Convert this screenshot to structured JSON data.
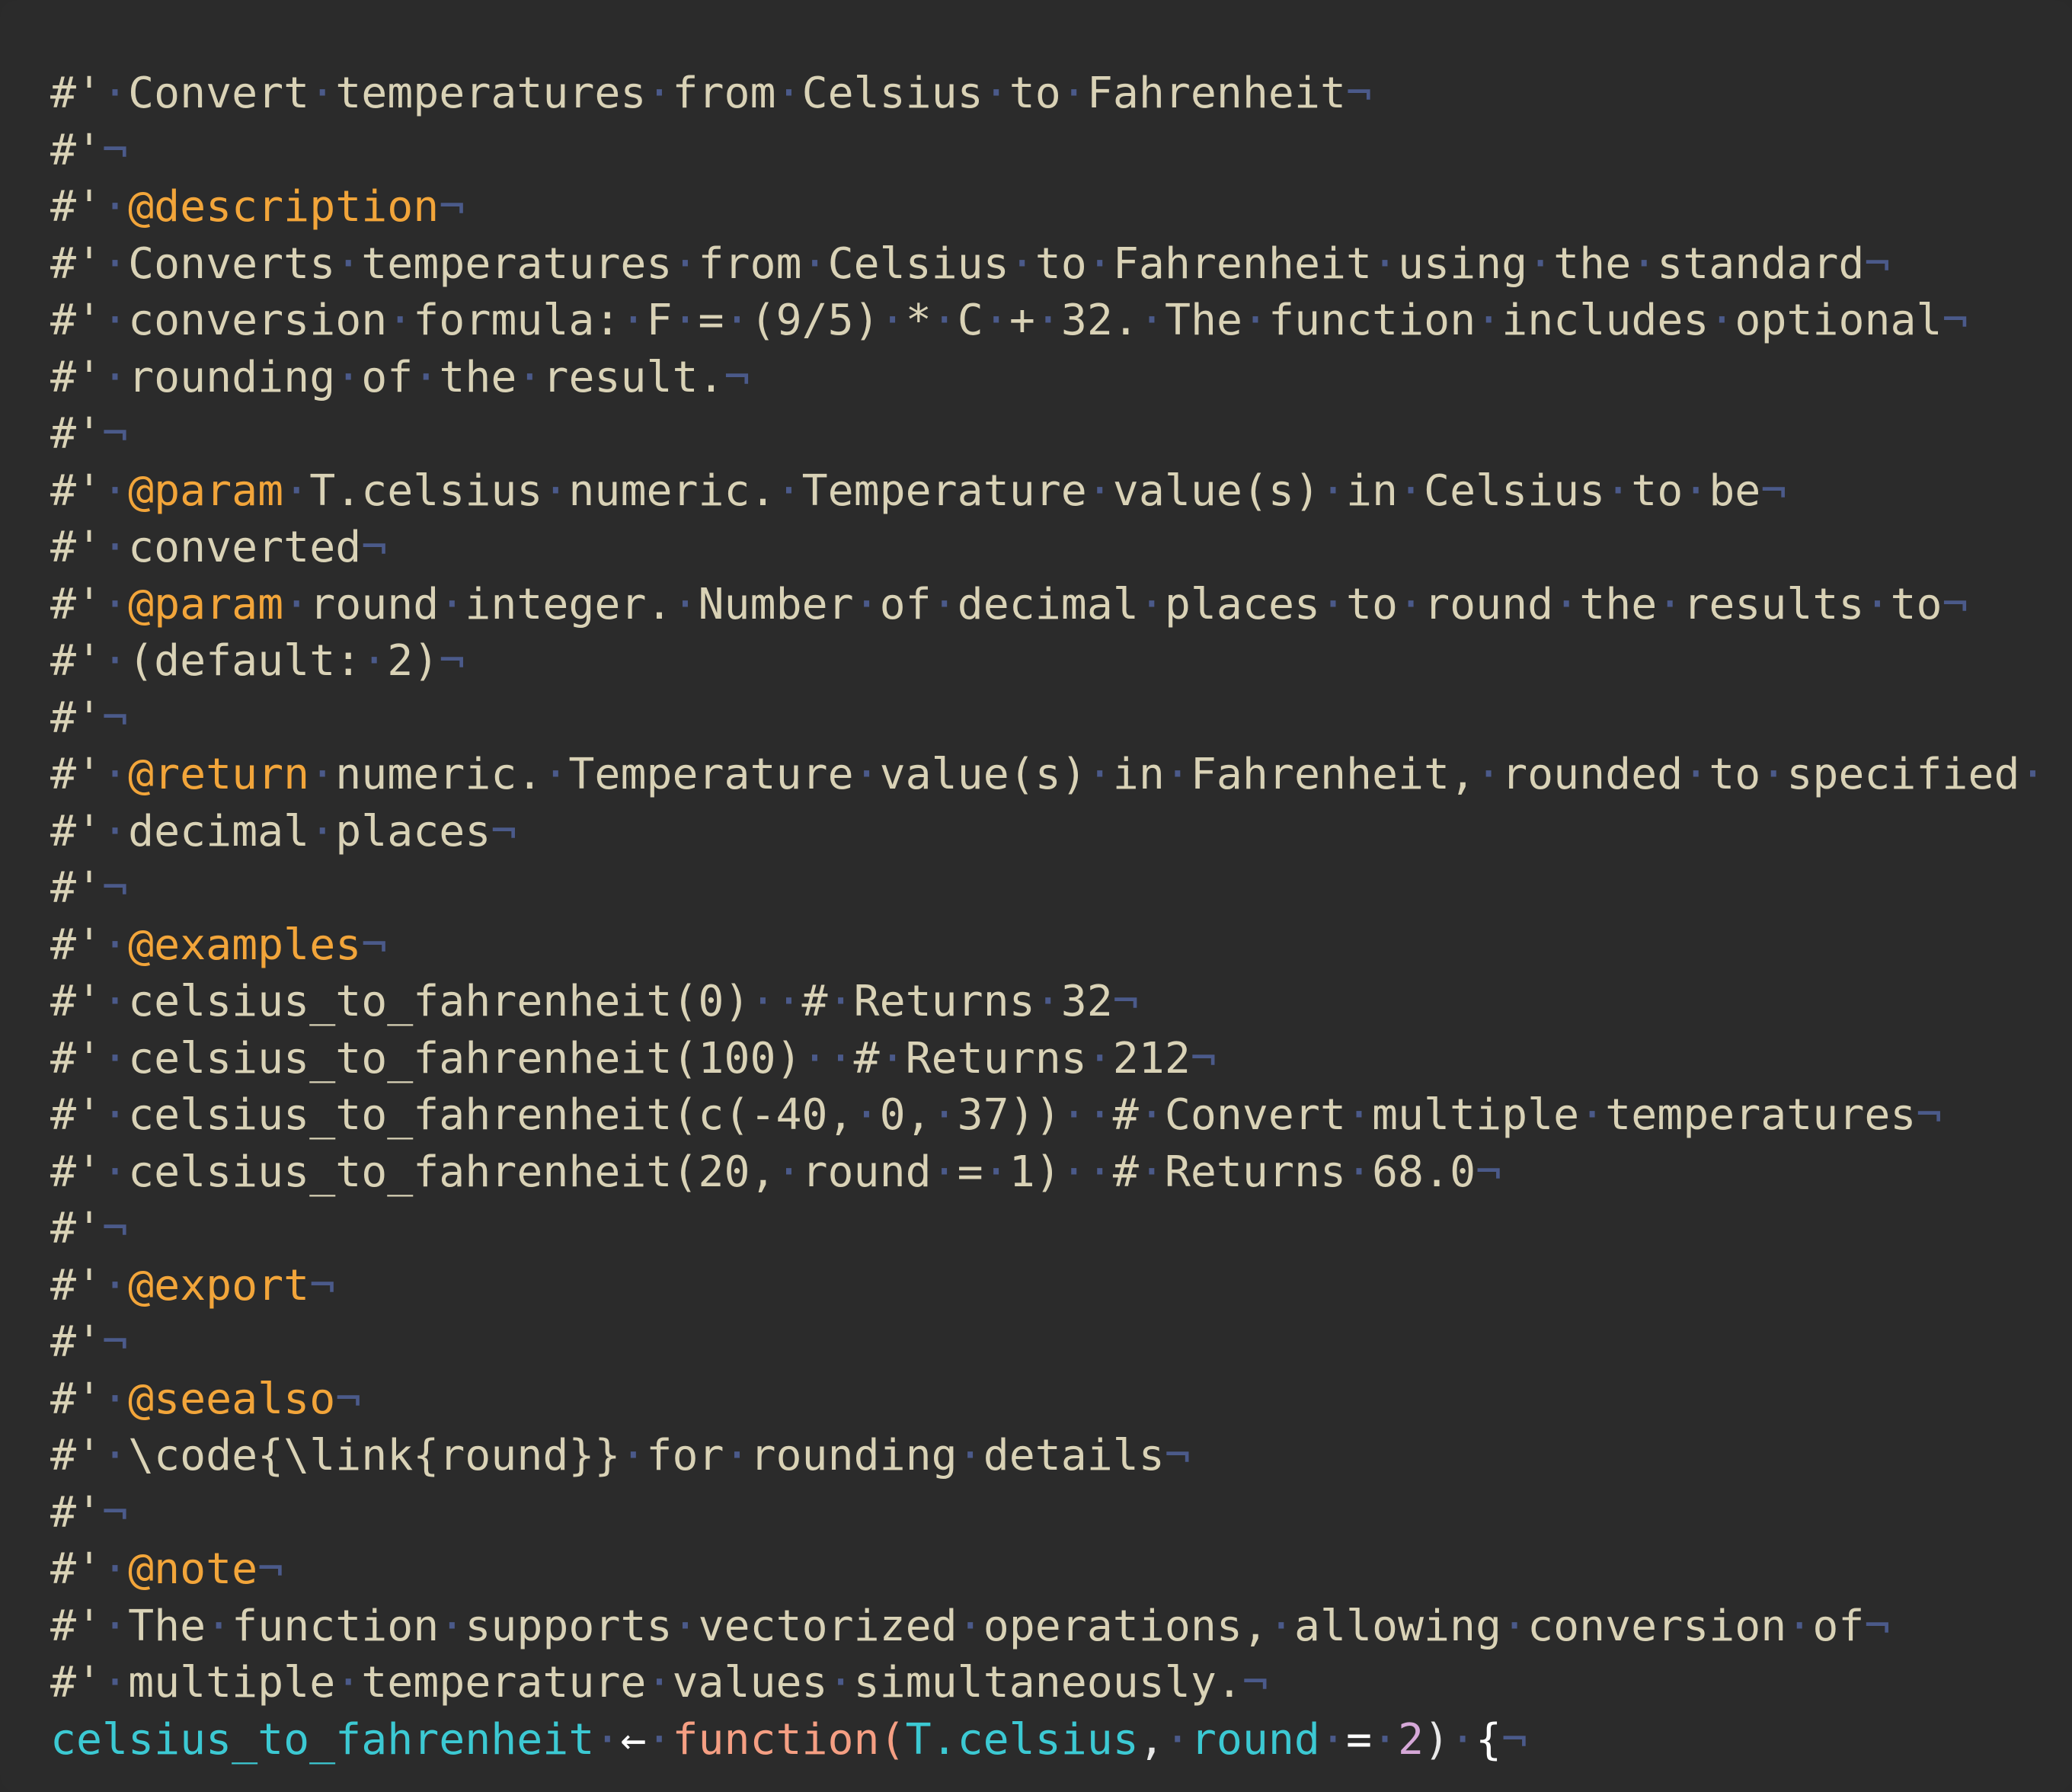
{
  "editor": {
    "whitespace_glyph": "·",
    "eol_glyph": "¬",
    "colors": {
      "background": "#2b2b2b",
      "text": "#d9d2b6",
      "whitespace_marker": "#4b5a8a",
      "roxygen_tag": "#f2a53a",
      "identifier": "#3cc9d3",
      "keyword": "#f59f83",
      "number": "#d6a8d8",
      "operator": "#ffffff"
    },
    "lines": [
      {
        "kind": "comment",
        "text": "Convert temperatures from Celsius to Fahrenheit",
        "eol": true
      },
      {
        "kind": "empty",
        "eol": true
      },
      {
        "kind": "tag",
        "tag": "@description",
        "text": "",
        "eol": true
      },
      {
        "kind": "comment",
        "text": "Converts temperatures from Celsius to Fahrenheit using the standard",
        "eol": true
      },
      {
        "kind": "comment",
        "text": "conversion formula: F = (9/5) * C + 32. The function includes optional",
        "eol": true
      },
      {
        "kind": "comment",
        "text": "rounding of the result.",
        "eol": true
      },
      {
        "kind": "empty",
        "eol": true
      },
      {
        "kind": "tag",
        "tag": "@param",
        "text": "T.celsius numeric. Temperature value(s) in Celsius to be",
        "eol": true
      },
      {
        "kind": "comment",
        "text": "converted",
        "eol": true
      },
      {
        "kind": "tag",
        "tag": "@param",
        "text": "round integer. Number of decimal places to round the results to",
        "eol": true
      },
      {
        "kind": "comment",
        "text": "(default: 2)",
        "eol": true
      },
      {
        "kind": "empty",
        "eol": true
      },
      {
        "kind": "tag",
        "tag": "@return",
        "text": "numeric. Temperature value(s) in Fahrenheit, rounded to specified ",
        "eol": false
      },
      {
        "kind": "comment",
        "text": "decimal places",
        "eol": true
      },
      {
        "kind": "empty",
        "eol": true
      },
      {
        "kind": "tag",
        "tag": "@examples",
        "text": "",
        "eol": true
      },
      {
        "kind": "comment",
        "text": "celsius_to_fahrenheit(0)  # Returns 32",
        "eol": true
      },
      {
        "kind": "comment",
        "text": "celsius_to_fahrenheit(100)  # Returns 212",
        "eol": true
      },
      {
        "kind": "comment",
        "text": "celsius_to_fahrenheit(c(-40, 0, 37))  # Convert multiple temperatures",
        "eol": true
      },
      {
        "kind": "comment",
        "text": "celsius_to_fahrenheit(20, round = 1)  # Returns 68.0",
        "eol": true
      },
      {
        "kind": "empty",
        "eol": true
      },
      {
        "kind": "tag",
        "tag": "@export",
        "text": "",
        "eol": true
      },
      {
        "kind": "empty",
        "eol": true
      },
      {
        "kind": "tag",
        "tag": "@seealso",
        "text": "",
        "eol": true
      },
      {
        "kind": "comment",
        "text": "\\code{\\link{round}} for rounding details",
        "eol": true
      },
      {
        "kind": "empty",
        "eol": true
      },
      {
        "kind": "tag",
        "tag": "@note",
        "text": "",
        "eol": true
      },
      {
        "kind": "comment",
        "text": "The function supports vectorized operations, allowing conversion of",
        "eol": true
      },
      {
        "kind": "comment",
        "text": "multiple temperature values simultaneously.",
        "eol": true
      },
      {
        "kind": "code",
        "tokens": [
          {
            "cls": "fn-name",
            "text": "celsius_to_fahrenheit"
          },
          {
            "cls": "ws",
            "text": " "
          },
          {
            "cls": "op",
            "text": "←"
          },
          {
            "cls": "ws",
            "text": " "
          },
          {
            "cls": "kw",
            "text": "function"
          },
          {
            "cls": "kw",
            "text": "("
          },
          {
            "cls": "fn-name",
            "text": "T.celsius"
          },
          {
            "cls": "punc",
            "text": ","
          },
          {
            "cls": "ws",
            "text": " "
          },
          {
            "cls": "fn-name",
            "text": "round"
          },
          {
            "cls": "ws",
            "text": " "
          },
          {
            "cls": "op",
            "text": "="
          },
          {
            "cls": "ws",
            "text": " "
          },
          {
            "cls": "num",
            "text": "2"
          },
          {
            "cls": "punc",
            "text": ")"
          },
          {
            "cls": "ws",
            "text": " "
          },
          {
            "cls": "op",
            "text": "{"
          }
        ],
        "eol": true
      }
    ]
  }
}
